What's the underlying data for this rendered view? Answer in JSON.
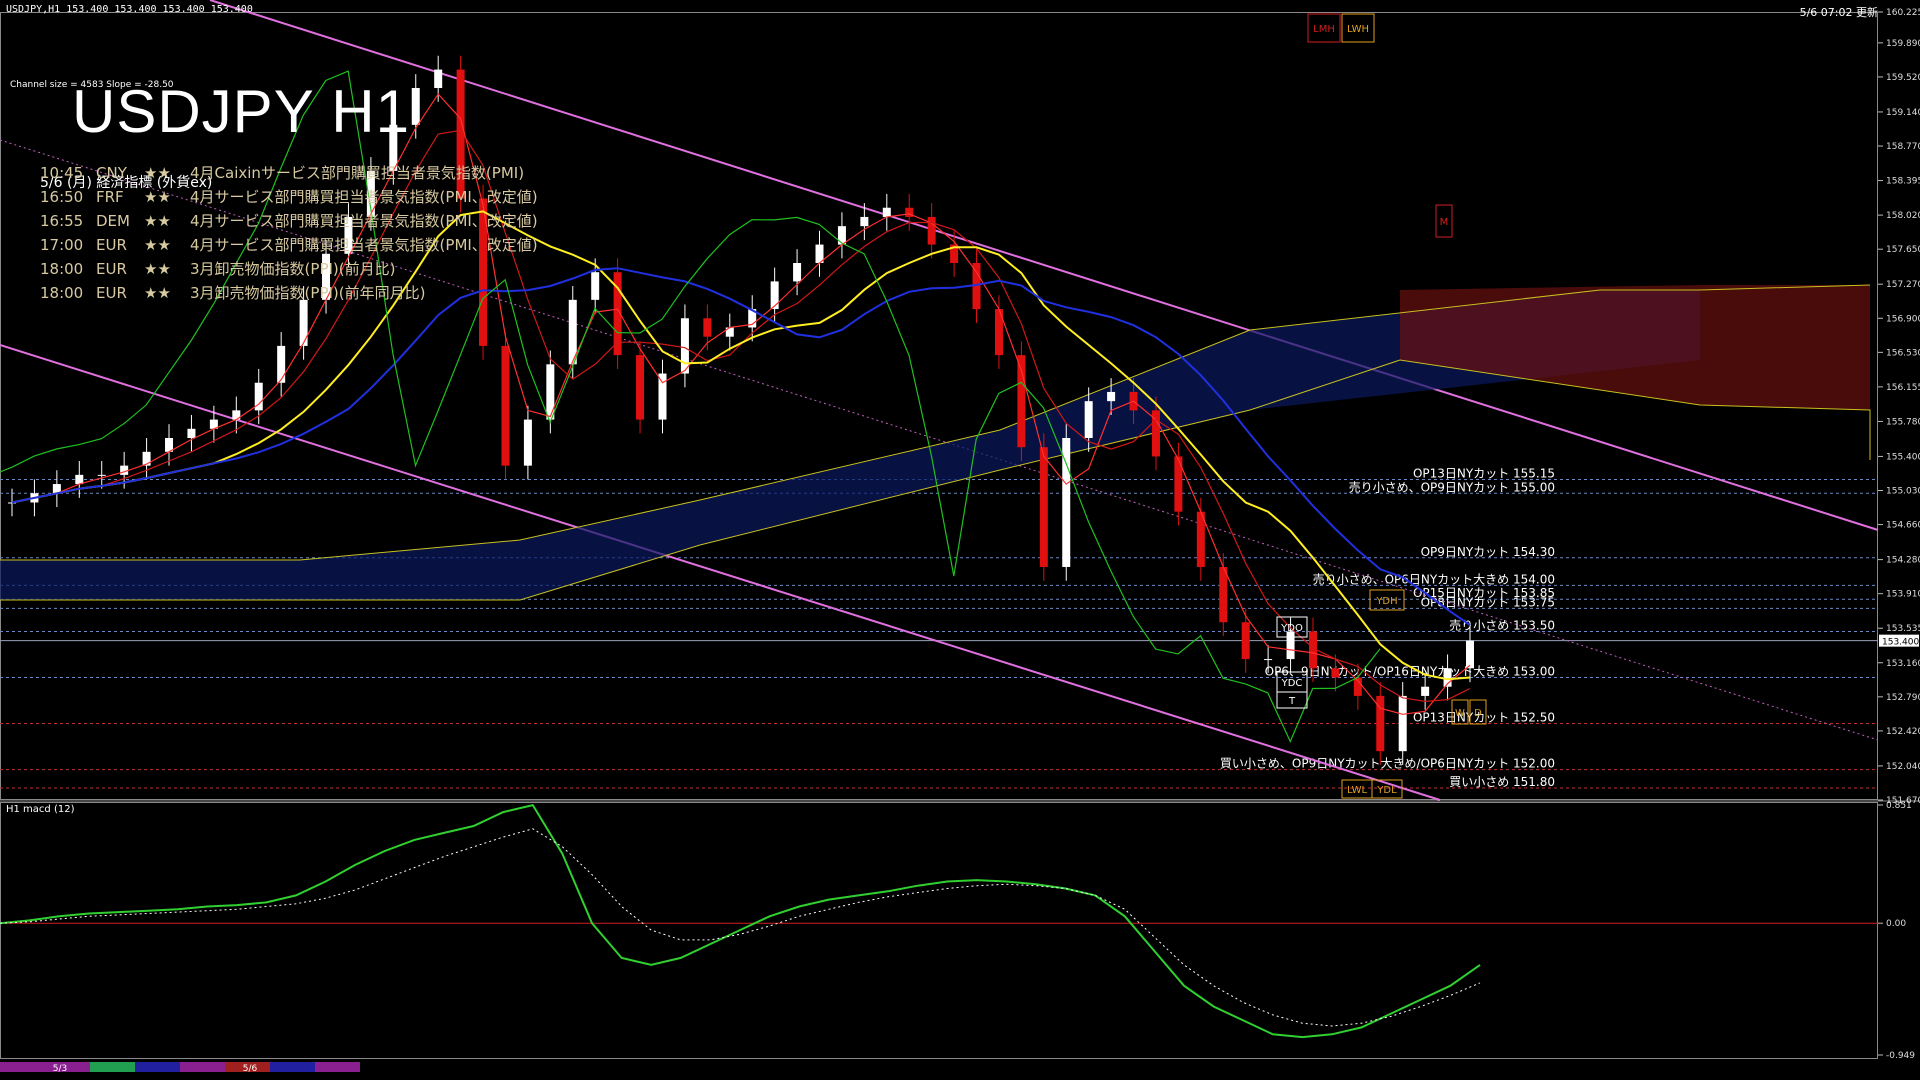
{
  "header": {
    "symbol_info": "USDJPY,H1  153.400 153.400 153.400 153.400",
    "time": "5/6 07:02 更新",
    "channel_info": "Channel size = 4583 Slope = -28.50",
    "big_title": "USDJPY H1",
    "events_header": "5/6 (月) 経済指標 (外貨ex)"
  },
  "events": [
    {
      "time": "10:45",
      "ccy": "CNY",
      "stars": "★★",
      "name": "4月Caixinサービス部門購買担当者景気指数(PMI)"
    },
    {
      "time": "16:50",
      "ccy": "FRF",
      "stars": "★★",
      "name": "4月サービス部門購買担当者景気指数(PMI、改定値)"
    },
    {
      "time": "16:55",
      "ccy": "DEM",
      "stars": "★★",
      "name": "4月サービス部門購買担当者景気指数(PMI、改定値)"
    },
    {
      "time": "17:00",
      "ccy": "EUR",
      "stars": "★★",
      "name": "4月サービス部門購買担当者景気指数(PMI、改定値)"
    },
    {
      "time": "18:00",
      "ccy": "EUR",
      "stars": "★★",
      "name": "3月卸売物価指数(PPI)(前月比)"
    },
    {
      "time": "18:00",
      "ccy": "EUR",
      "stars": "★★",
      "name": "3月卸売物価指数(PPI)(前年同月比)"
    }
  ],
  "level_labels": [
    {
      "text": "OP13日NYカット 155.15",
      "price": 155.15
    },
    {
      "text": "売り小さめ、OP9日NYカット 155.00",
      "price": 155.0
    },
    {
      "text": "OP9日NYカット 154.30",
      "price": 154.3
    },
    {
      "text": "売り小さめ、OP6日NYカット大きめ 154.00",
      "price": 154.0
    },
    {
      "text": "OP15日NYカット 153.85",
      "price": 153.85
    },
    {
      "text": "OP8日NYカット 153.75",
      "price": 153.75
    },
    {
      "text": "売り小さめ 153.50",
      "price": 153.5
    },
    {
      "text": "OP6、9日NYカット/OP16日NYカット大きめ 153.00",
      "price": 153.0
    },
    {
      "text": "OP13日NYカット 152.50",
      "price": 152.5
    },
    {
      "text": "買い小さめ、OP9日NYカット大きめ/OP6日NYカット 152.00",
      "price": 152.0
    },
    {
      "text": "買い小さめ 151.80",
      "price": 151.8
    }
  ],
  "marker_boxes": {
    "lmh": "LMH",
    "lwh": "LWH",
    "m": "M",
    "ydh": "YDH",
    "ydo": "YDO",
    "ydc": "YDC",
    "t": "T",
    "w": "W",
    "d": "D",
    "lwl": "LWL",
    "ydl": "YDL"
  },
  "chart_data": {
    "type": "candlestick",
    "price_axis": {
      "ticks": [
        "160.225",
        "159.890",
        "159.520",
        "159.140",
        "158.770",
        "158.395",
        "158.020",
        "157.650",
        "157.270",
        "156.900",
        "156.530",
        "156.155",
        "155.780",
        "155.400",
        "155.030",
        "154.660",
        "154.280",
        "153.910",
        "153.535",
        "153.160",
        "152.790",
        "152.420",
        "152.040",
        "151.670"
      ],
      "current": "153.400",
      "range": [
        151.67,
        160.225
      ]
    },
    "x_labels": [
      "5/3",
      "5/6"
    ],
    "close_path": [
      154.9,
      155.0,
      155.1,
      155.2,
      155.2,
      155.3,
      155.45,
      155.6,
      155.7,
      155.8,
      155.9,
      156.2,
      156.6,
      157.1,
      157.6,
      158.0,
      158.5,
      159.0,
      159.4,
      159.6,
      158.2,
      156.6,
      155.3,
      155.8,
      156.4,
      157.1,
      157.4,
      156.5,
      155.8,
      156.3,
      156.9,
      156.7,
      156.8,
      157.0,
      157.3,
      157.5,
      157.7,
      157.9,
      158.0,
      158.1,
      158.0,
      157.7,
      157.5,
      157.0,
      156.5,
      155.5,
      154.2,
      155.6,
      156.0,
      156.1,
      155.9,
      155.4,
      154.8,
      154.2,
      153.6,
      153.2,
      153.2,
      153.5,
      153.1,
      153.0,
      152.8,
      152.2,
      152.8,
      152.9,
      153.1,
      153.4
    ],
    "macd": {
      "label": "H1  macd (12)",
      "axis_ticks": [
        "0.851",
        "0.00",
        "-0.949"
      ],
      "range": [
        -0.949,
        0.851
      ],
      "main": [
        0.0,
        0.02,
        0.05,
        0.07,
        0.08,
        0.09,
        0.1,
        0.12,
        0.13,
        0.15,
        0.2,
        0.3,
        0.42,
        0.52,
        0.6,
        0.65,
        0.7,
        0.8,
        0.85,
        0.5,
        0.0,
        -0.25,
        -0.3,
        -0.25,
        -0.15,
        -0.05,
        0.05,
        0.12,
        0.17,
        0.2,
        0.23,
        0.27,
        0.3,
        0.31,
        0.3,
        0.28,
        0.25,
        0.2,
        0.05,
        -0.2,
        -0.45,
        -0.6,
        -0.7,
        -0.8,
        -0.82,
        -0.8,
        -0.75,
        -0.65,
        -0.55,
        -0.45,
        -0.3
      ],
      "signal": [
        0.0,
        0.01,
        0.03,
        0.05,
        0.06,
        0.07,
        0.08,
        0.09,
        0.1,
        0.12,
        0.14,
        0.18,
        0.24,
        0.32,
        0.4,
        0.48,
        0.55,
        0.62,
        0.68,
        0.55,
        0.35,
        0.12,
        -0.05,
        -0.12,
        -0.12,
        -0.08,
        -0.02,
        0.05,
        0.1,
        0.15,
        0.19,
        0.22,
        0.25,
        0.27,
        0.28,
        0.27,
        0.25,
        0.2,
        0.1,
        -0.1,
        -0.3,
        -0.45,
        -0.57,
        -0.66,
        -0.72,
        -0.74,
        -0.72,
        -0.67,
        -0.6,
        -0.52,
        -0.43
      ]
    }
  }
}
